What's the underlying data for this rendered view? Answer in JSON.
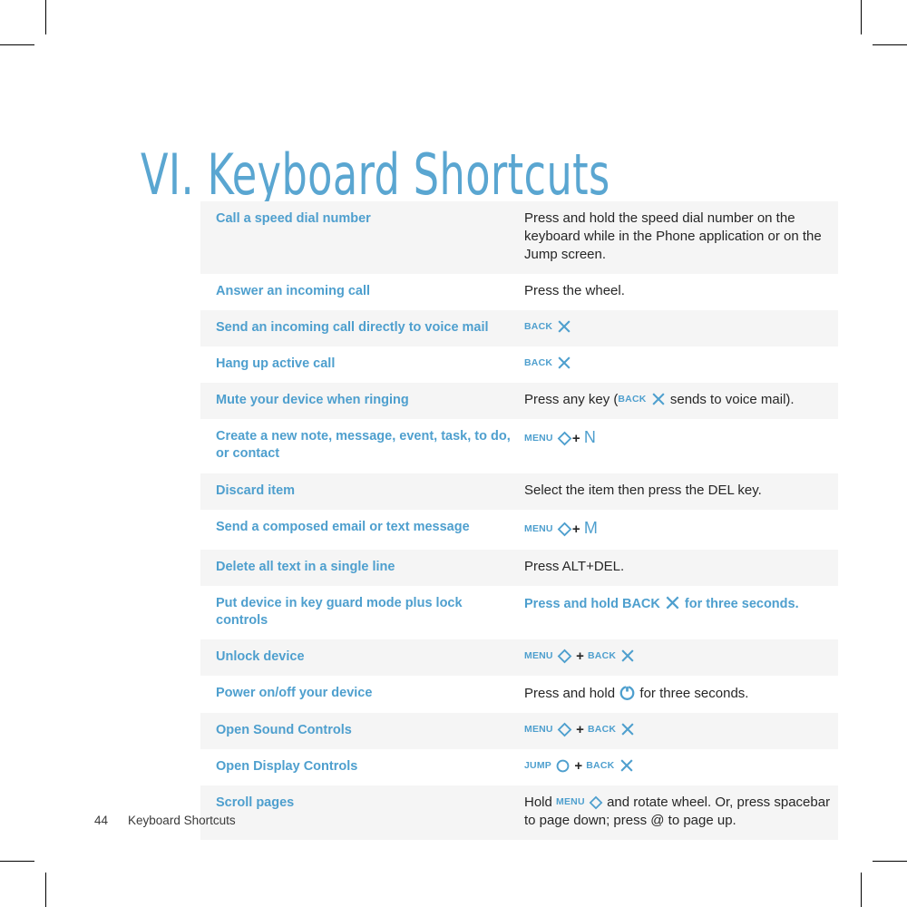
{
  "page": {
    "title": "VI. Keyboard Shortcuts",
    "footer_page_number": "44",
    "footer_section": "Keyboard Shortcuts"
  },
  "colors": {
    "accent_blue": "#4e9fce",
    "title_blue": "#5aa6d1",
    "row_shaded": "#f5f5f5",
    "row_plain": "#ffffff",
    "body_text": "#262626"
  },
  "icons": {
    "back": {
      "label": "BACK",
      "glyph": "x-icon"
    },
    "menu": {
      "label": "MENU",
      "glyph": "diamond-icon"
    },
    "jump": {
      "label": "JUMP",
      "glyph": "circle-icon"
    },
    "power": {
      "label": "",
      "glyph": "power-icon"
    }
  },
  "table": {
    "rows": [
      {
        "action": "Call a speed dial number",
        "detail": "Press and hold the speed dial number on the keyboard while in the Phone application or on the Jump screen.",
        "shaded": true
      },
      {
        "action": "Answer an incoming call",
        "detail": "Press the wheel.",
        "shaded": false
      },
      {
        "action": "Send an incoming call directly to voice mail",
        "detail": "",
        "detail_parts": {
          "back_label": "BACK"
        },
        "shaded": true
      },
      {
        "action": "Hang up active call",
        "detail": "",
        "detail_parts": {
          "back_label": "BACK"
        },
        "shaded": false
      },
      {
        "action": "Mute your device when ringing",
        "detail": "",
        "detail_parts": {
          "pre": "Press any key (",
          "back_label": "BACK",
          "post": " sends to voice mail)."
        },
        "shaded": true
      },
      {
        "action": "Create a new note, message, event, task, to do, or contact",
        "detail": "",
        "detail_parts": {
          "menu_label": "MENU",
          "plus": "+",
          "letter": "N"
        },
        "shaded": false
      },
      {
        "action": "Discard item",
        "detail": "Select the item then press the DEL key.",
        "shaded": true
      },
      {
        "action": "Send a composed email or text message",
        "detail": "",
        "detail_parts": {
          "menu_label": "MENU",
          "plus": "+",
          "letter": "M"
        },
        "shaded": false
      },
      {
        "action": "Delete all text in a single line",
        "detail": "Press ALT+DEL.",
        "shaded": true
      },
      {
        "action": "Put device in key guard mode plus lock controls",
        "detail": "",
        "detail_parts": {
          "pre": "Press and hold BACK",
          "post": "for three seconds."
        },
        "blue": true,
        "shaded": false
      },
      {
        "action": "Unlock device",
        "detail": "",
        "detail_parts": {
          "menu_label": "MENU",
          "plus": "+",
          "back_label": "BACK"
        },
        "shaded": true
      },
      {
        "action": "Power on/off your device",
        "detail": "",
        "detail_parts": {
          "pre": "Press and hold",
          "post": "for three seconds."
        },
        "shaded": false
      },
      {
        "action": "Open Sound Controls",
        "detail": "",
        "detail_parts": {
          "menu_label": "MENU",
          "plus": "+",
          "back_label": "BACK"
        },
        "shaded": true
      },
      {
        "action": "Open Display Controls",
        "detail": "",
        "detail_parts": {
          "jump_label": "JUMP",
          "plus": "+",
          "back_label": "BACK"
        },
        "shaded": false
      },
      {
        "action": "Scroll pages",
        "detail": "",
        "detail_parts": {
          "pre": "Hold",
          "menu_label": "MENU",
          "post": "and rotate wheel. Or, press spacebar to page down; press @ to page up."
        },
        "shaded": true
      }
    ]
  }
}
